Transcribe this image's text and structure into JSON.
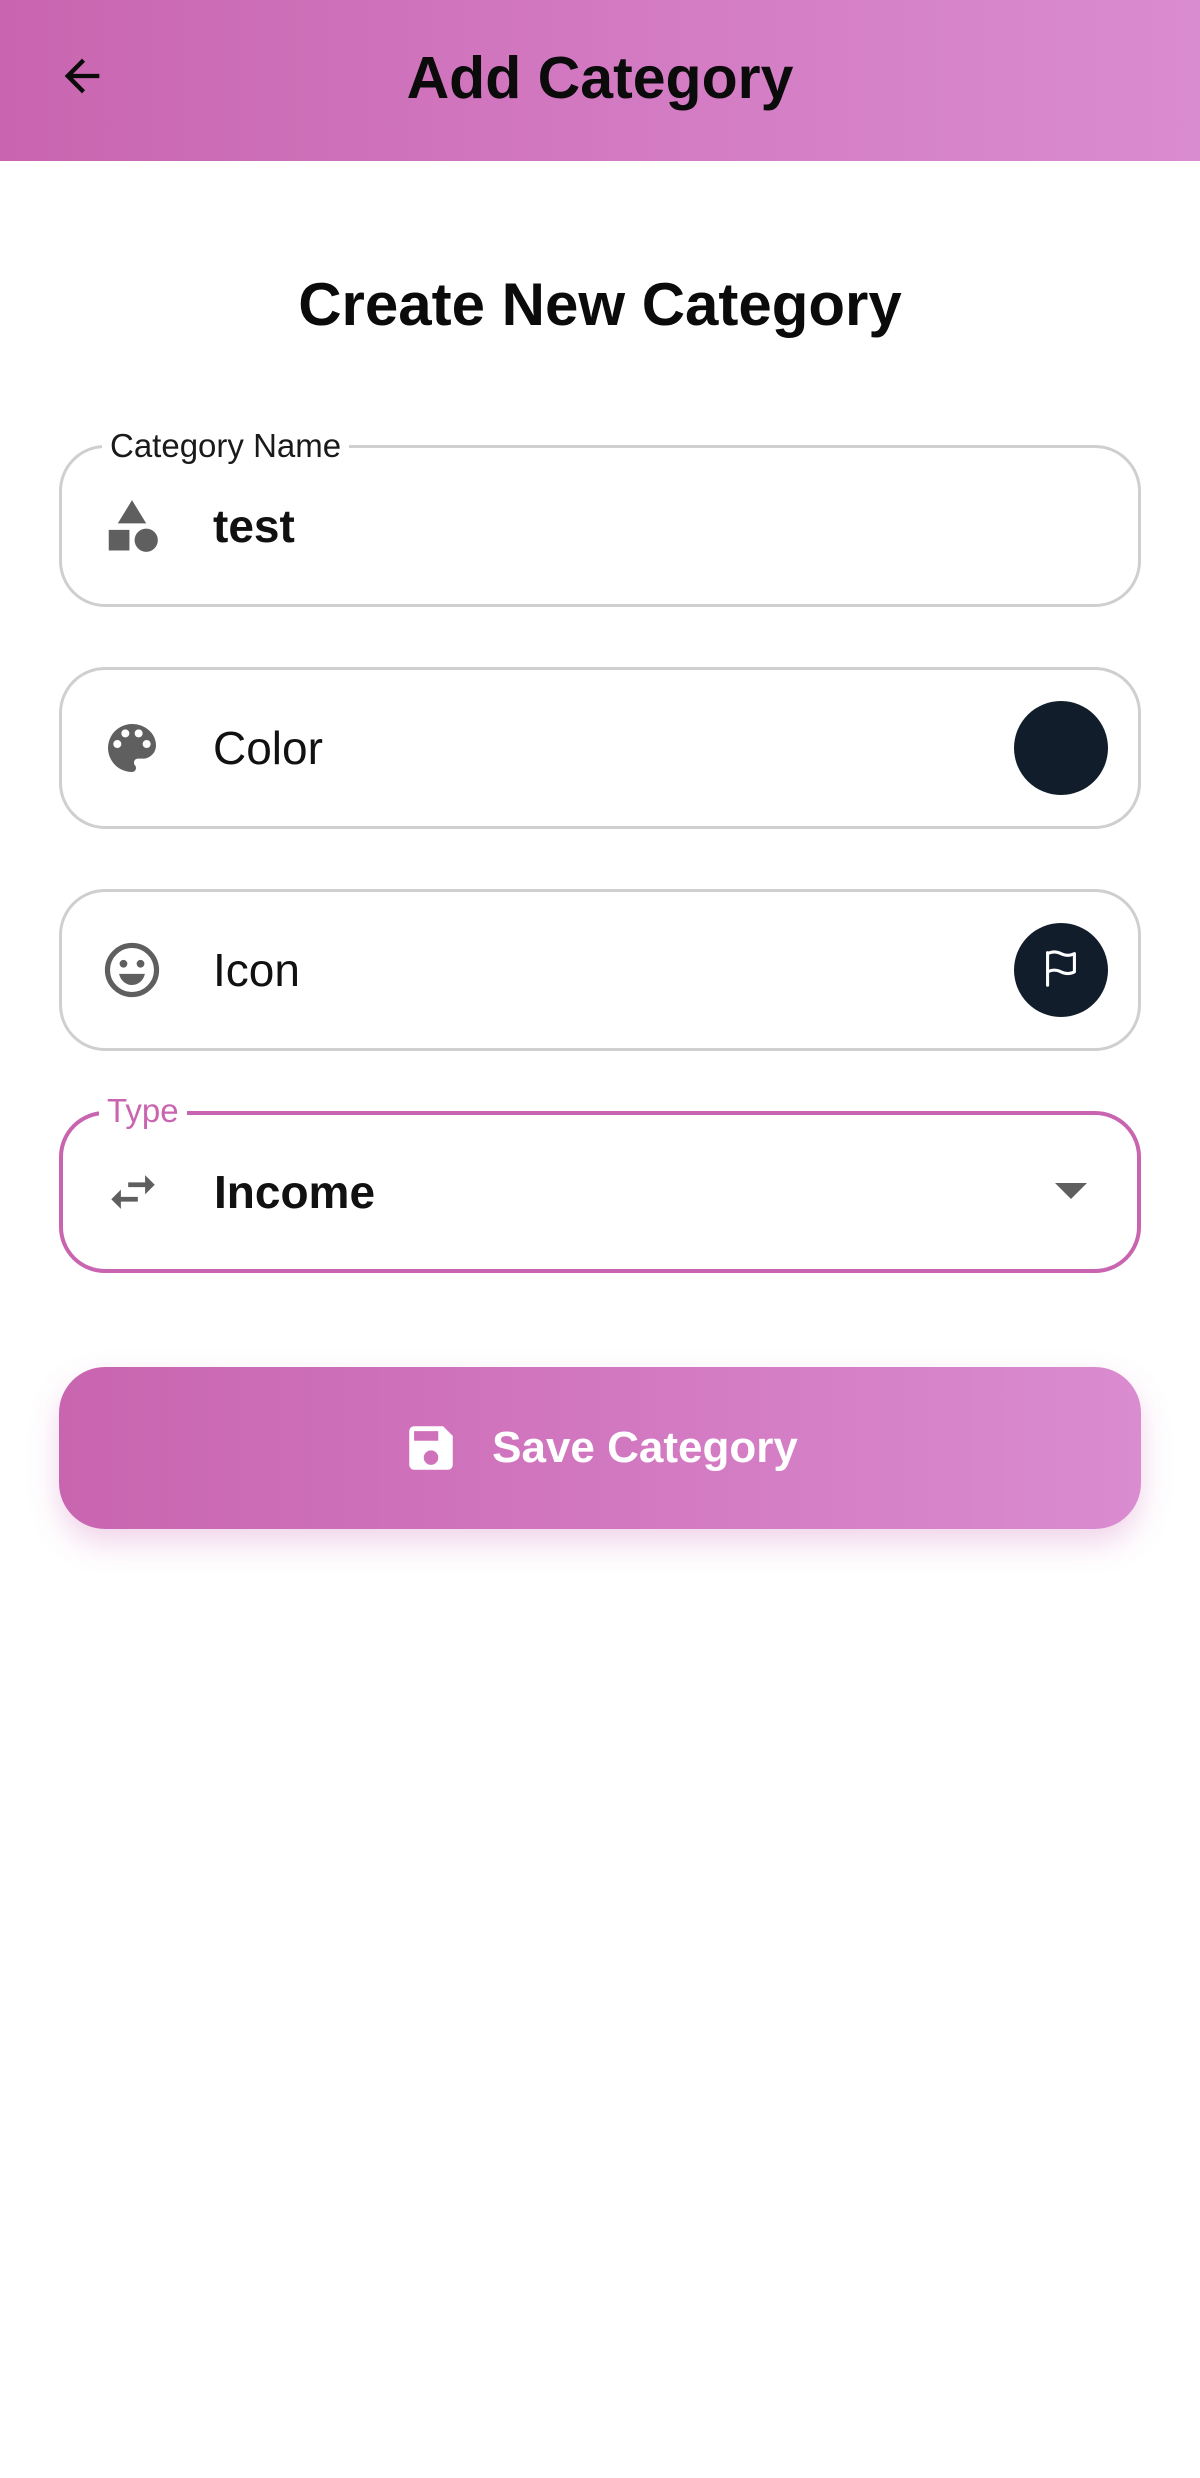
{
  "header": {
    "title": "Add Category",
    "back_icon": "arrow-left-icon",
    "gradient_start": "#c965b0",
    "gradient_end": "#da8cd0"
  },
  "form": {
    "heading": "Create New Category",
    "name_field": {
      "label": "Category Name",
      "value": "test",
      "icon": "category-shapes-icon"
    },
    "color_field": {
      "label": "Color",
      "icon": "palette-icon",
      "selected_color": "#121d2c"
    },
    "icon_field": {
      "label": "Icon",
      "icon": "emoji-icon",
      "selected_icon": "flag-icon",
      "selected_icon_bg": "#121d2c"
    },
    "type_field": {
      "label": "Type",
      "value": "Income",
      "icon": "swap-arrows-icon",
      "accent_color": "#c965b0"
    },
    "save_button": {
      "label": "Save Category",
      "icon": "save-icon"
    }
  }
}
